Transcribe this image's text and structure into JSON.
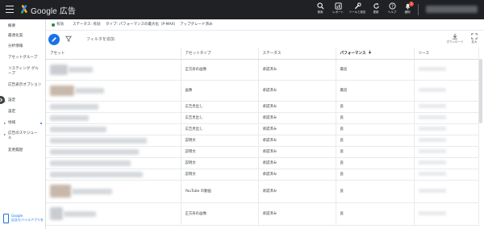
{
  "topbar": {
    "brand": "Google 広告",
    "icons": [
      {
        "name": "search-icon",
        "label": "検索"
      },
      {
        "name": "report-icon",
        "label": "レポート"
      },
      {
        "name": "tools-icon",
        "label": "ツールと設定"
      },
      {
        "name": "refresh-icon",
        "label": "更新"
      },
      {
        "name": "help-icon",
        "label": "ヘルプ"
      },
      {
        "name": "notifications-icon",
        "label": "通知",
        "badge": "1"
      }
    ]
  },
  "sidebar": {
    "items": [
      {
        "label": "概要"
      },
      {
        "label": "最適化案"
      },
      {
        "label": "分析情報"
      },
      {
        "label": "アセットグループ"
      },
      {
        "label": "リスティング グループ"
      },
      {
        "label": "広告表示オプション"
      },
      {
        "label": "設定"
      },
      {
        "label": "設定"
      },
      {
        "label": "地域"
      },
      {
        "label": "広告のスケジュール"
      },
      {
        "label": "変更履歴"
      }
    ],
    "promo": {
      "line1": "Google",
      "line2": "広告モバイルアプリを"
    }
  },
  "context": {
    "status": "有効",
    "status_filter": "ステータス: 有効",
    "type_filter": "タイプ: パフォーマンスの最大化（P-MAX）",
    "upgrade": "アップグレード済み"
  },
  "toolbar": {
    "filter_placeholder": "フィルタを追加",
    "download_label": "ダウンロード",
    "expand_label": "拡大"
  },
  "table": {
    "columns": [
      "アセット",
      "アセットタイプ",
      "ステータス",
      "パフォーマンス",
      "ソース"
    ],
    "rows": [
      {
        "type": "正方形の画像",
        "status": "承認済み",
        "performance": "最良"
      },
      {
        "type": "画像",
        "status": "承認済み",
        "performance": "最良"
      },
      {
        "type": "広告見出し",
        "status": "承認済み",
        "performance": "良"
      },
      {
        "type": "広告見出し",
        "status": "承認済み",
        "performance": "良"
      },
      {
        "type": "広告見出し",
        "status": "承認済み",
        "performance": "良"
      },
      {
        "type": "説明文",
        "status": "承認済み",
        "performance": "良"
      },
      {
        "type": "説明文",
        "status": "承認済み",
        "performance": "良"
      },
      {
        "type": "説明文",
        "status": "承認済み",
        "performance": "良"
      },
      {
        "type": "説明文",
        "status": "承認済み",
        "performance": "良"
      },
      {
        "type": "YouTube の動画",
        "status": "承認済み",
        "performance": "良"
      },
      {
        "type": "正方形の画像",
        "status": "承認済み",
        "performance": "良"
      }
    ]
  },
  "colors": {
    "topbar": "#202124",
    "accent": "#1a73e8",
    "status_green": "#1e8e3e",
    "badge": "#ea4335"
  }
}
